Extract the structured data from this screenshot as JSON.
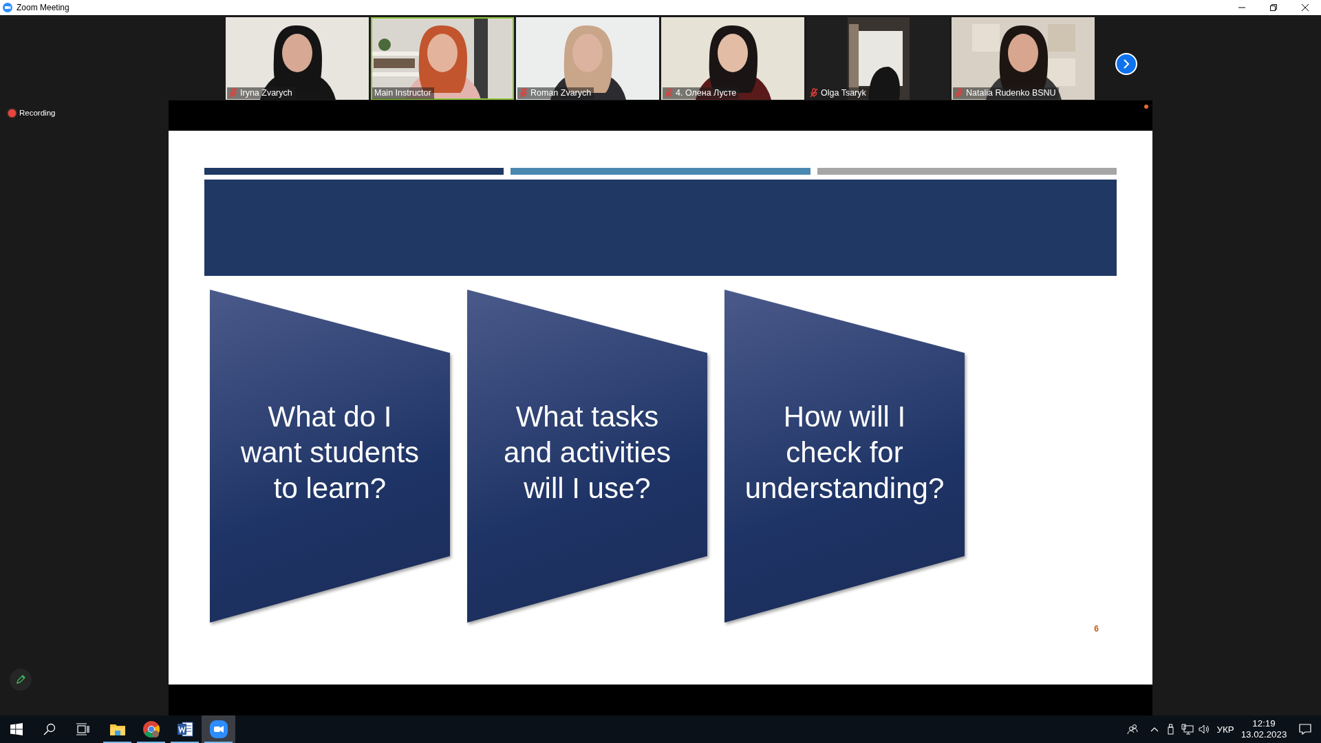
{
  "window": {
    "title": "Zoom Meeting"
  },
  "participants": [
    {
      "name": "Iryna Zvarych",
      "muted": true,
      "speaking": false
    },
    {
      "name": "Main Instructor",
      "muted": false,
      "speaking": true
    },
    {
      "name": "Roman Zvarych",
      "muted": true,
      "speaking": false
    },
    {
      "name": "4. Олена Лусте",
      "muted": true,
      "speaking": false
    },
    {
      "name": "Olga Tsaryk",
      "muted": true,
      "speaking": false
    },
    {
      "name": "Natalia Rudenko BSNU",
      "muted": true,
      "speaking": false
    }
  ],
  "recording": {
    "label": "Recording"
  },
  "slide": {
    "cards": [
      {
        "text": "What do I\nwant students\nto learn?"
      },
      {
        "text": "What tasks\nand activities\nwill I use?"
      },
      {
        "text": "How will I\ncheck for\nunderstanding?"
      }
    ],
    "page_number": "6"
  },
  "taskbar": {
    "apps": [
      {
        "kind": "explorer",
        "active": false
      },
      {
        "kind": "chrome",
        "active": false
      },
      {
        "kind": "word",
        "active": false
      },
      {
        "kind": "zoom",
        "active": true
      }
    ],
    "language": "УКР",
    "time": "12:19",
    "date": "13.02.2023"
  }
}
